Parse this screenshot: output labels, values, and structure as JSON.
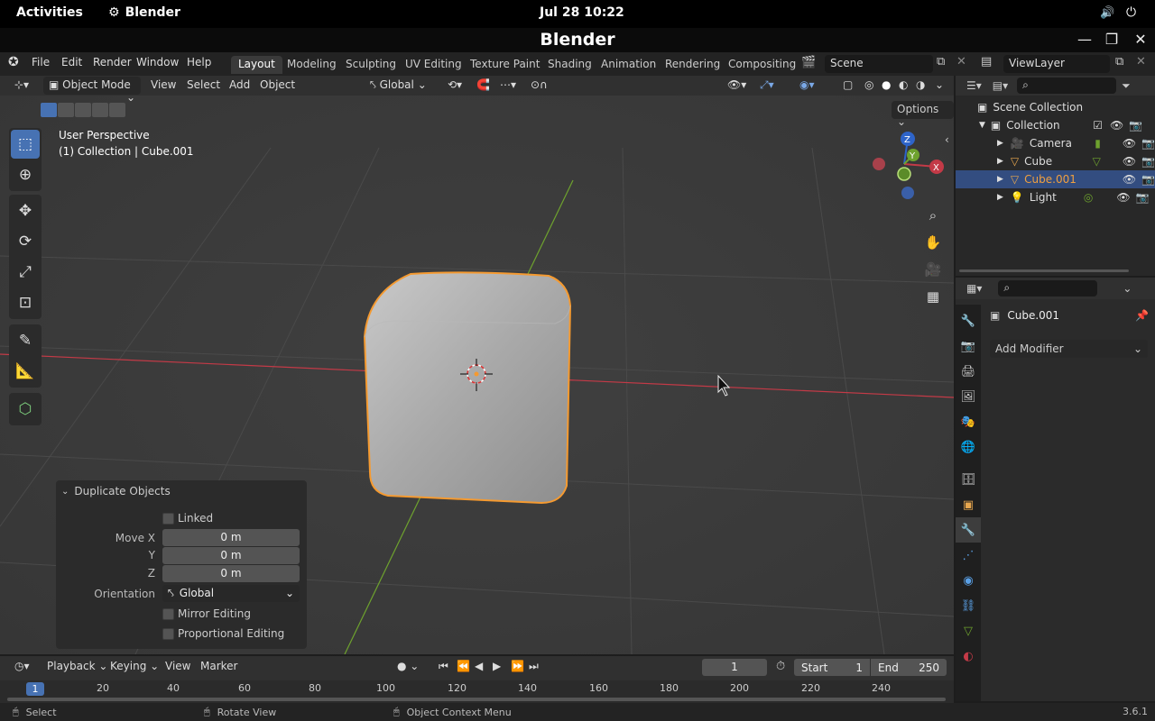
{
  "gnome": {
    "activities": "Activities",
    "app_name": "Blender",
    "clock": "Jul 28  10:22"
  },
  "window": {
    "title": "Blender"
  },
  "menu": {
    "file": "File",
    "edit": "Edit",
    "render": "Render",
    "window": "Window",
    "help": "Help"
  },
  "workspaces": [
    "Layout",
    "Modeling",
    "Sculpting",
    "UV Editing",
    "Texture Paint",
    "Shading",
    "Animation",
    "Rendering",
    "Compositing"
  ],
  "scene": {
    "name": "Scene"
  },
  "viewlayer": {
    "name": "ViewLayer"
  },
  "viewport": {
    "mode": "Object Mode",
    "view": "View",
    "select": "Select",
    "add": "Add",
    "object": "Object",
    "orientation": "Global",
    "options": "Options",
    "perspective": "User Perspective",
    "collection_info": "(1) Collection | Cube.001"
  },
  "operator_panel": {
    "title": "Duplicate Objects",
    "linked": "Linked",
    "move_x_label": "Move X",
    "move_x": "0 m",
    "y_label": "Y",
    "y": "0 m",
    "z_label": "Z",
    "z": "0 m",
    "orientation_label": "Orientation",
    "orientation": "Global",
    "mirror": "Mirror Editing",
    "proportional": "Proportional Editing"
  },
  "outliner": {
    "scene_collection": "Scene Collection",
    "collection": "Collection",
    "items": [
      "Camera",
      "Cube",
      "Cube.001",
      "Light"
    ]
  },
  "properties": {
    "object_name": "Cube.001",
    "add_modifier": "Add Modifier"
  },
  "timeline": {
    "playback": "Playback",
    "keying": "Keying",
    "view": "View",
    "marker": "Marker",
    "current_frame": "1",
    "start_label": "Start",
    "start": "1",
    "end_label": "End",
    "end": "250",
    "ruler": [
      "20",
      "40",
      "60",
      "80",
      "100",
      "120",
      "140",
      "160",
      "180",
      "200",
      "220",
      "240"
    ],
    "frame_marker": "1"
  },
  "status": {
    "select": "Select",
    "rotate": "Rotate View",
    "context": "Object Context Menu",
    "version": "3.6.1"
  },
  "gizmo": {
    "z": "Z",
    "y": "Y",
    "x": "X"
  },
  "colors": {
    "accent": "#4772b3",
    "selection_outline": "#f59a30",
    "x_axis": "#c33a47",
    "y_axis": "#6ea22e"
  }
}
